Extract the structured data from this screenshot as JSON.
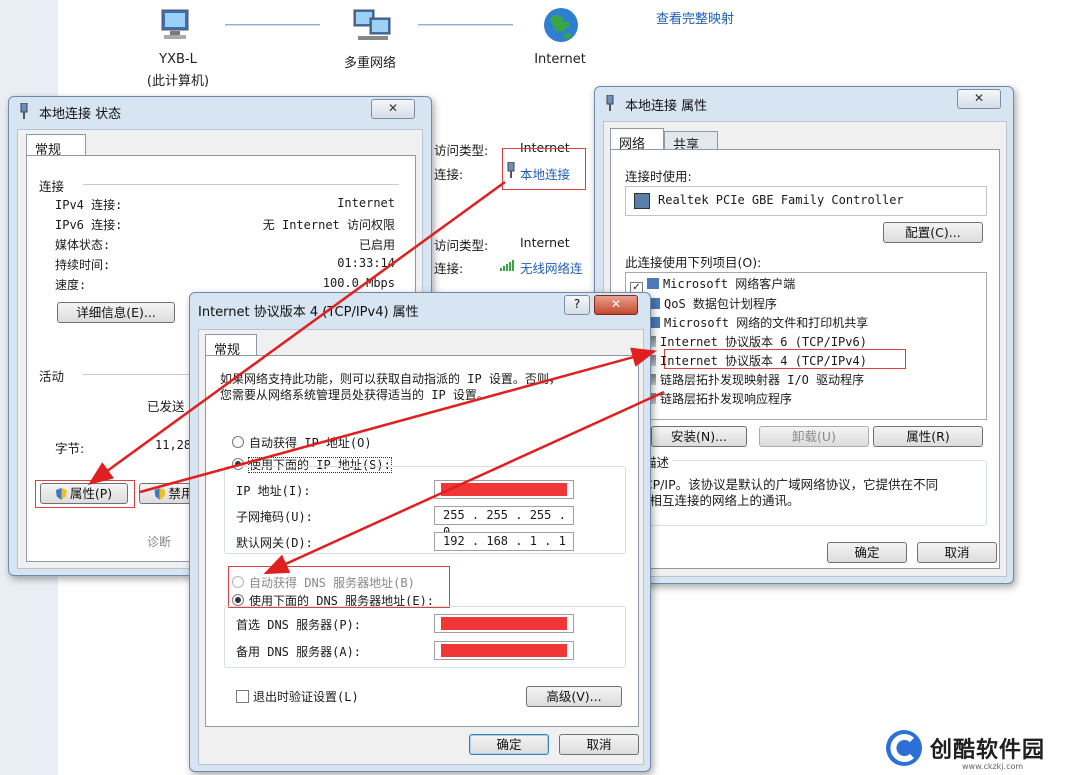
{
  "network_map": {
    "computer_name": "YXB-L",
    "computer_sub": "(此计算机)",
    "network_name": "多重网络",
    "internet_name": "Internet",
    "full_map_link": "查看完整映射"
  },
  "background_panel": {
    "access_type_label": "访问类型:",
    "access_type_value": "Internet",
    "connection_label": "连接:",
    "connection_value": "本地连接",
    "access_type_label_2": "访问类型:",
    "access_type_value_2": "Internet",
    "connection_label_2": "连接:",
    "connection_value_2": "无线网络连"
  },
  "status_window": {
    "title": "本地连接 状态",
    "close": "✕",
    "tab": "常规",
    "section_connection": "连接",
    "rows": [
      {
        "label": "IPv4 连接:",
        "value": "Internet"
      },
      {
        "label": "IPv6 连接:",
        "value": "无 Internet 访问权限"
      },
      {
        "label": "媒体状态:",
        "value": "已启用"
      },
      {
        "label": "持续时间:",
        "value": "01:33:14"
      },
      {
        "label": "速度:",
        "value": "100.0 Mbps"
      }
    ],
    "details_button": "详细信息(E)...",
    "section_activity": "活动",
    "sent_label": "已发送",
    "bytes_label": "字节:",
    "bytes_value": "11,28",
    "properties_button": "属性(P)",
    "disable_button": "禁用",
    "diagnose_button": "诊断"
  },
  "props_window": {
    "title": "本地连接 属性",
    "close": "✕",
    "tab_network": "网络",
    "tab_share": "共享",
    "connect_using_label": "连接时使用:",
    "adapter": "Realtek PCIe GBE Family Controller",
    "configure_button": "配置(C)...",
    "items_label": "此连接使用下列项目(O):",
    "items": [
      {
        "label": "Microsoft 网络客户端"
      },
      {
        "label": "QoS 数据包计划程序"
      },
      {
        "label": "Microsoft 网络的文件和打印机共享"
      },
      {
        "label": "Internet 协议版本 6 (TCP/IPv6)"
      },
      {
        "label": "Internet 协议版本 4 (TCP/IPv4)"
      },
      {
        "label": "链路层拓扑发现映射器 I/O 驱动程序"
      },
      {
        "label": "链路层拓扑发现响应程序"
      }
    ],
    "install_button": "安装(N)...",
    "uninstall_button": "卸载(U)",
    "properties_button": "属性(R)",
    "desc_title": "描述",
    "desc_text_1": "TCP/IP。该协议是默认的广域网络协议，它提供在不同",
    "desc_text_2": "的相互连接的网络上的通讯。",
    "ok_button": "确定",
    "cancel_button": "取消"
  },
  "ipv4_window": {
    "title": "Internet 协议版本 4 (TCP/IPv4) 属性",
    "help": "?",
    "close": "✕",
    "tab": "常规",
    "intro_1": "如果网络支持此功能，则可以获取自动指派的 IP 设置。否则，",
    "intro_2": "您需要从网络系统管理员处获得适当的 IP 设置。",
    "auto_ip": "自动获得 IP 地址(O)",
    "manual_ip": "使用下面的 IP 地址(S):",
    "ip_label": "IP 地址(I):",
    "mask_label": "子网掩码(U):",
    "mask_value": "255 . 255 . 255 .  0",
    "gateway_label": "默认网关(D):",
    "gateway_value": "192 . 168 .  1  .  1",
    "auto_dns": "自动获得 DNS 服务器地址(B)",
    "manual_dns": "使用下面的 DNS 服务器地址(E):",
    "dns1_label": "首选 DNS 服务器(P):",
    "dns2_label": "备用 DNS 服务器(A):",
    "validate_label": "退出时验证设置(L)",
    "advanced_button": "高级(V)...",
    "ok_button": "确定",
    "cancel_button": "取消"
  },
  "watermark": {
    "brand": "创酷软件园",
    "url": "www.ckzkj.com"
  },
  "colors": {
    "annotation_red": "#e02020",
    "redaction": "#f03636",
    "link_blue": "#1f5fb8"
  }
}
